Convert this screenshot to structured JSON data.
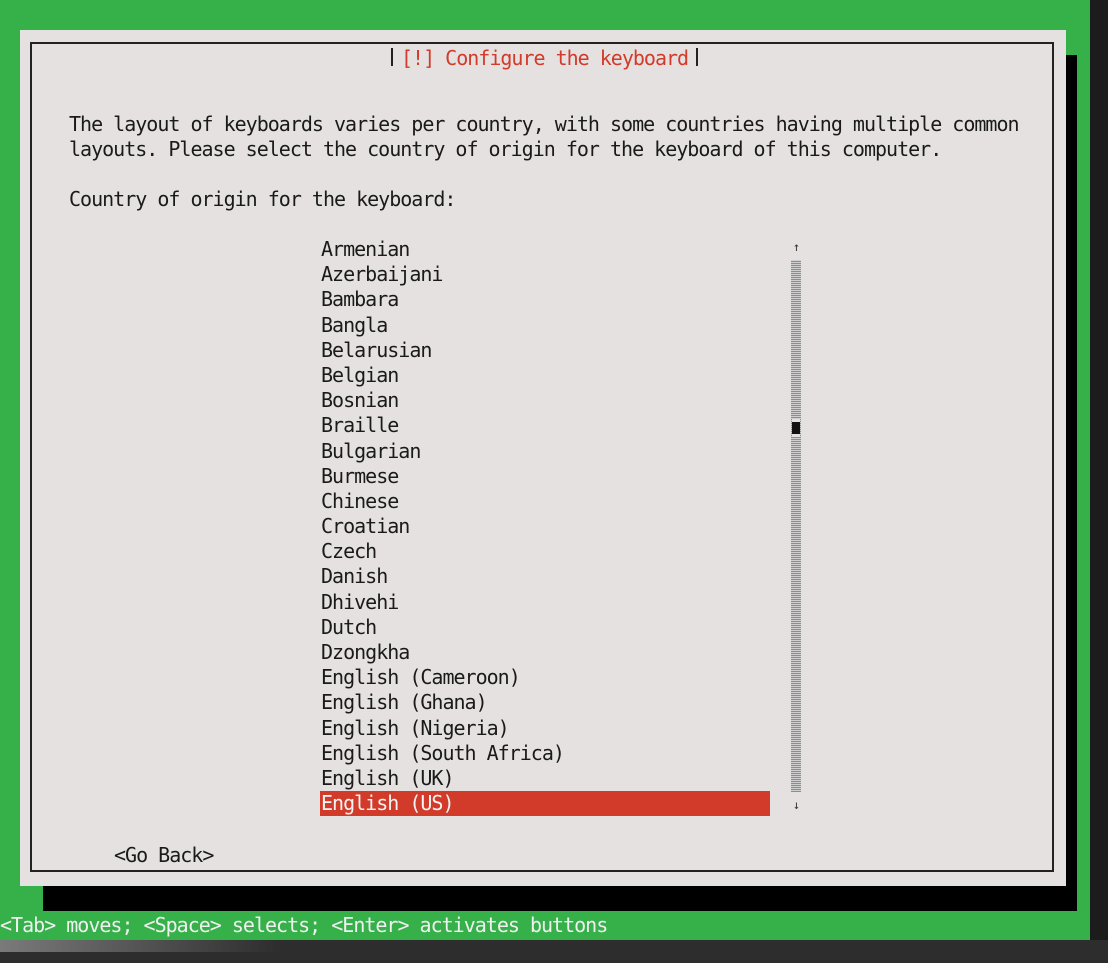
{
  "dialog": {
    "title": "[!] Configure the keyboard",
    "description_line1": "The layout of keyboards varies per country, with some countries having multiple common",
    "description_line2": "layouts. Please select the country of origin for the keyboard of this computer.",
    "prompt": "Country of origin for the keyboard:",
    "options": [
      "Armenian",
      "Azerbaijani",
      "Bambara",
      "Bangla",
      "Belarusian",
      "Belgian",
      "Bosnian",
      "Braille",
      "Bulgarian",
      "Burmese",
      "Chinese",
      "Croatian",
      "Czech",
      "Danish",
      "Dhivehi",
      "Dutch",
      "Dzongkha",
      "English (Cameroon)",
      "English (Ghana)",
      "English (Nigeria)",
      "English (South Africa)",
      "English (UK)",
      "English (US)"
    ],
    "selected_option": "English (US)",
    "go_back_label": "<Go Back>"
  },
  "scrollbar": {
    "up_arrow": "↑",
    "down_arrow": "↓"
  },
  "help_line": "<Tab> moves; <Space> selects; <Enter> activates buttons",
  "colors": {
    "background": "#36b14a",
    "dialog": "#e5e1e1",
    "accent": "#d23a29",
    "text": "#1a1a1a"
  }
}
